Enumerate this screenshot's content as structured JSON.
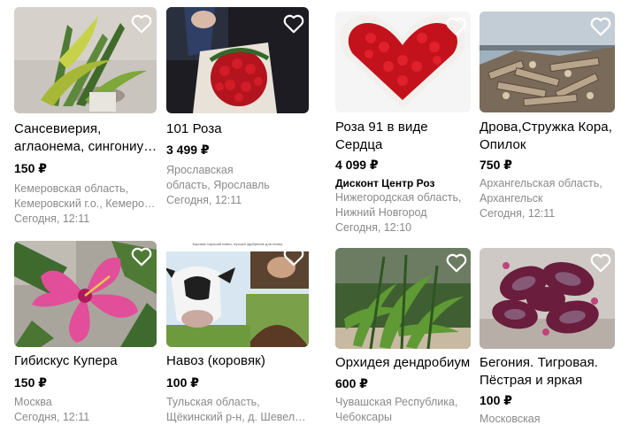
{
  "colors": {
    "text": "#000000",
    "meta": "#8a8a8a",
    "favorite_icon": "#ffffff",
    "background": "#ffffff"
  },
  "listings": [
    {
      "title_lines": [
        "Сансевиерия,",
        "аглаонема, сингониу…"
      ],
      "price": "150 ₽",
      "meta_lines": [
        "Кемеровская область,",
        "Кемеровский г.о., Кемеро…",
        "Сегодня, 12:11"
      ],
      "image": "plants-in-pot-photo",
      "favorite_icon": "heart-outline-icon"
    },
    {
      "title_lines": [
        "101 Роза"
      ],
      "price": "3 499 ₽",
      "meta_lines": [
        "Ярославская",
        "область, Ярославль",
        "Сегодня, 12:11"
      ],
      "image": "rose-bouquet-photo",
      "favorite_icon": "heart-outline-icon"
    },
    {
      "title_lines": [
        "Роза 91 в виде",
        "Сердца"
      ],
      "price": "4 099 ₽",
      "seller": "Дисконт Центр Роз",
      "meta_lines": [
        "Нижегородская область,",
        "Нижний Новгород",
        "Сегодня, 12:10"
      ],
      "image": "heart-of-roses-photo",
      "favorite_icon": "heart-outline-icon"
    },
    {
      "title_lines": [
        "Дрова,Стружка Кора,",
        "Опилок"
      ],
      "price": "750 ₽",
      "meta_lines": [
        "Архангельская область,",
        "Архангельск",
        "Сегодня, 12:11"
      ],
      "image": "firewood-pile-photo",
      "favorite_icon": "heart-outline-icon"
    },
    {
      "title_lines": [
        "Гибискус Купера"
      ],
      "price": "150 ₽",
      "meta_lines": [
        "Москва",
        "Сегодня, 12:11"
      ],
      "image": "hibiscus-flower-photo",
      "favorite_icon": "heart-outline-icon"
    },
    {
      "title_lines": [
        "Навоз (коровяк)"
      ],
      "price": "100 ₽",
      "meta_lines": [
        "Тульская область,",
        "Щёкинский р-н, д. Шевел…"
      ],
      "image": "cow-and-manure-photo",
      "image_caption": "Коровяк хороший навоз, лучшее удобрение для почвы",
      "favorite_icon": "heart-outline-icon"
    },
    {
      "title_lines": [
        "Орхидея дендробиум"
      ],
      "price": "600 ₽",
      "meta_lines": [
        "Чувашская Республика,",
        "Чебоксары"
      ],
      "image": "dendrobium-orchid-photo",
      "favorite_icon": "heart-outline-icon"
    },
    {
      "title_lines": [
        "Бегония. Тигровая.",
        "Пёстрая и яркая"
      ],
      "price": "100 ₽",
      "meta_lines": [
        "Московская"
      ],
      "image": "begonia-plant-photo",
      "favorite_icon": "heart-outline-icon"
    }
  ]
}
